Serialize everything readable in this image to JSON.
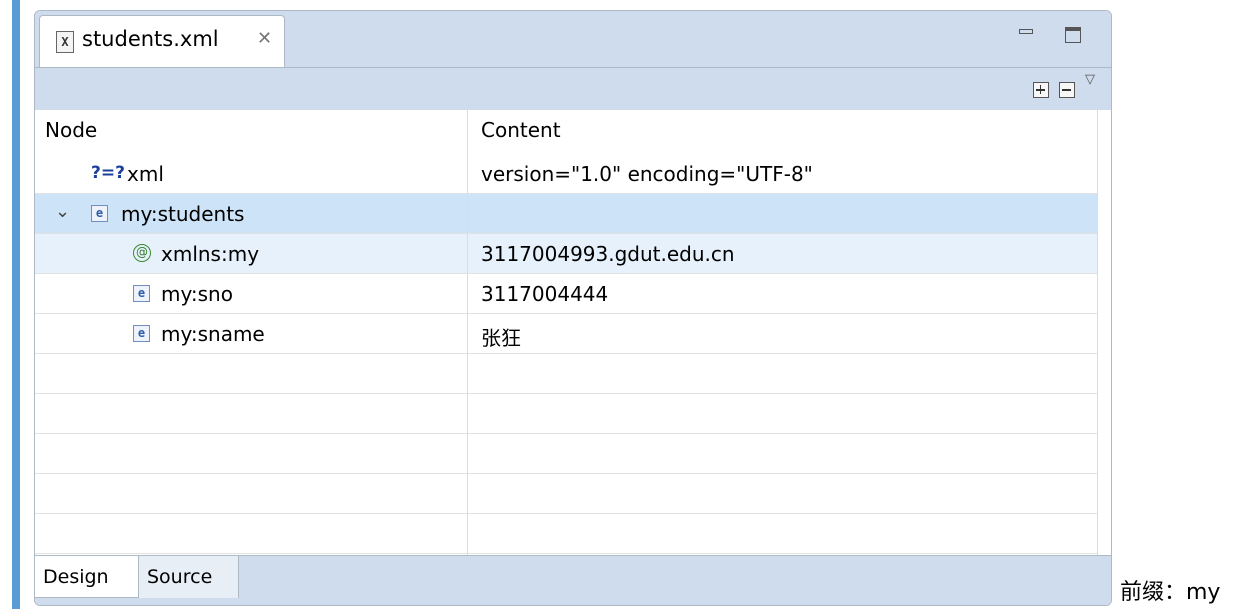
{
  "editor": {
    "tab_title": "students.xml",
    "tab_close_glyph": "✕",
    "file_icon_letter": "X"
  },
  "toolbar": {
    "menu_glyph": "▽"
  },
  "table": {
    "header": {
      "node": "Node",
      "content": "Content"
    },
    "rows": [
      {
        "icon": "processing-instruction-icon",
        "icon_glyph": "?=?",
        "node": "xml",
        "content": "version=\"1.0\" encoding=\"UTF-8\""
      },
      {
        "icon": "element-icon",
        "icon_glyph": "e",
        "node": "my:students",
        "content": "",
        "expanded": true
      },
      {
        "icon": "attribute-icon",
        "icon_glyph": "@",
        "node": "xmlns:my",
        "content": "3117004993.gdut.edu.cn"
      },
      {
        "icon": "element-icon",
        "icon_glyph": "e",
        "node": "my:sno",
        "content": "3117004444"
      },
      {
        "icon": "element-icon",
        "icon_glyph": "e",
        "node": "my:sname",
        "content": "张狂"
      }
    ],
    "expand_glyph": "⌄"
  },
  "bottom_tabs": [
    {
      "label": "Design",
      "active": true
    },
    {
      "label": "Source",
      "active": false
    }
  ],
  "side_note": "前缀：my"
}
